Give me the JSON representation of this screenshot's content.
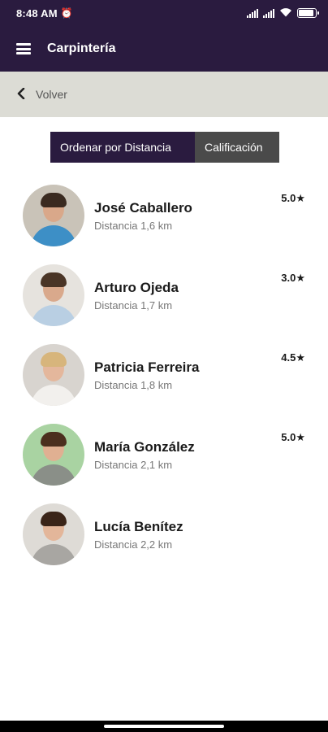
{
  "status_bar": {
    "time": "8:48 AM",
    "alarm_icon": "alarm-clock-icon",
    "battery_level": 0.9
  },
  "app_bar": {
    "title": "Carpintería",
    "menu_icon": "hamburger-menu-icon"
  },
  "back_bar": {
    "label": "Volver",
    "icon": "chevron-left-icon"
  },
  "sort": {
    "options": [
      "Ordenar por Distancia",
      "Calificación"
    ],
    "selected": "Ordenar por Distancia"
  },
  "colors": {
    "primary": "#2a1b3f",
    "secondary_bar": "#dcdcd5",
    "inactive_button": "#4a4a4a"
  },
  "professionals": [
    {
      "name": "José Caballero",
      "distance": "Distancia 1,6 km",
      "rating": "5.0★"
    },
    {
      "name": "Arturo Ojeda",
      "distance": "Distancia 1,7 km",
      "rating": "3.0★"
    },
    {
      "name": "Patricia Ferreira",
      "distance": "Distancia 1,8 km",
      "rating": "4.5★"
    },
    {
      "name": "María González",
      "distance": "Distancia 2,1 km",
      "rating": "5.0★"
    },
    {
      "name": "Lucía Benítez",
      "distance": "Distancia 2,2 km",
      "rating": ""
    }
  ]
}
